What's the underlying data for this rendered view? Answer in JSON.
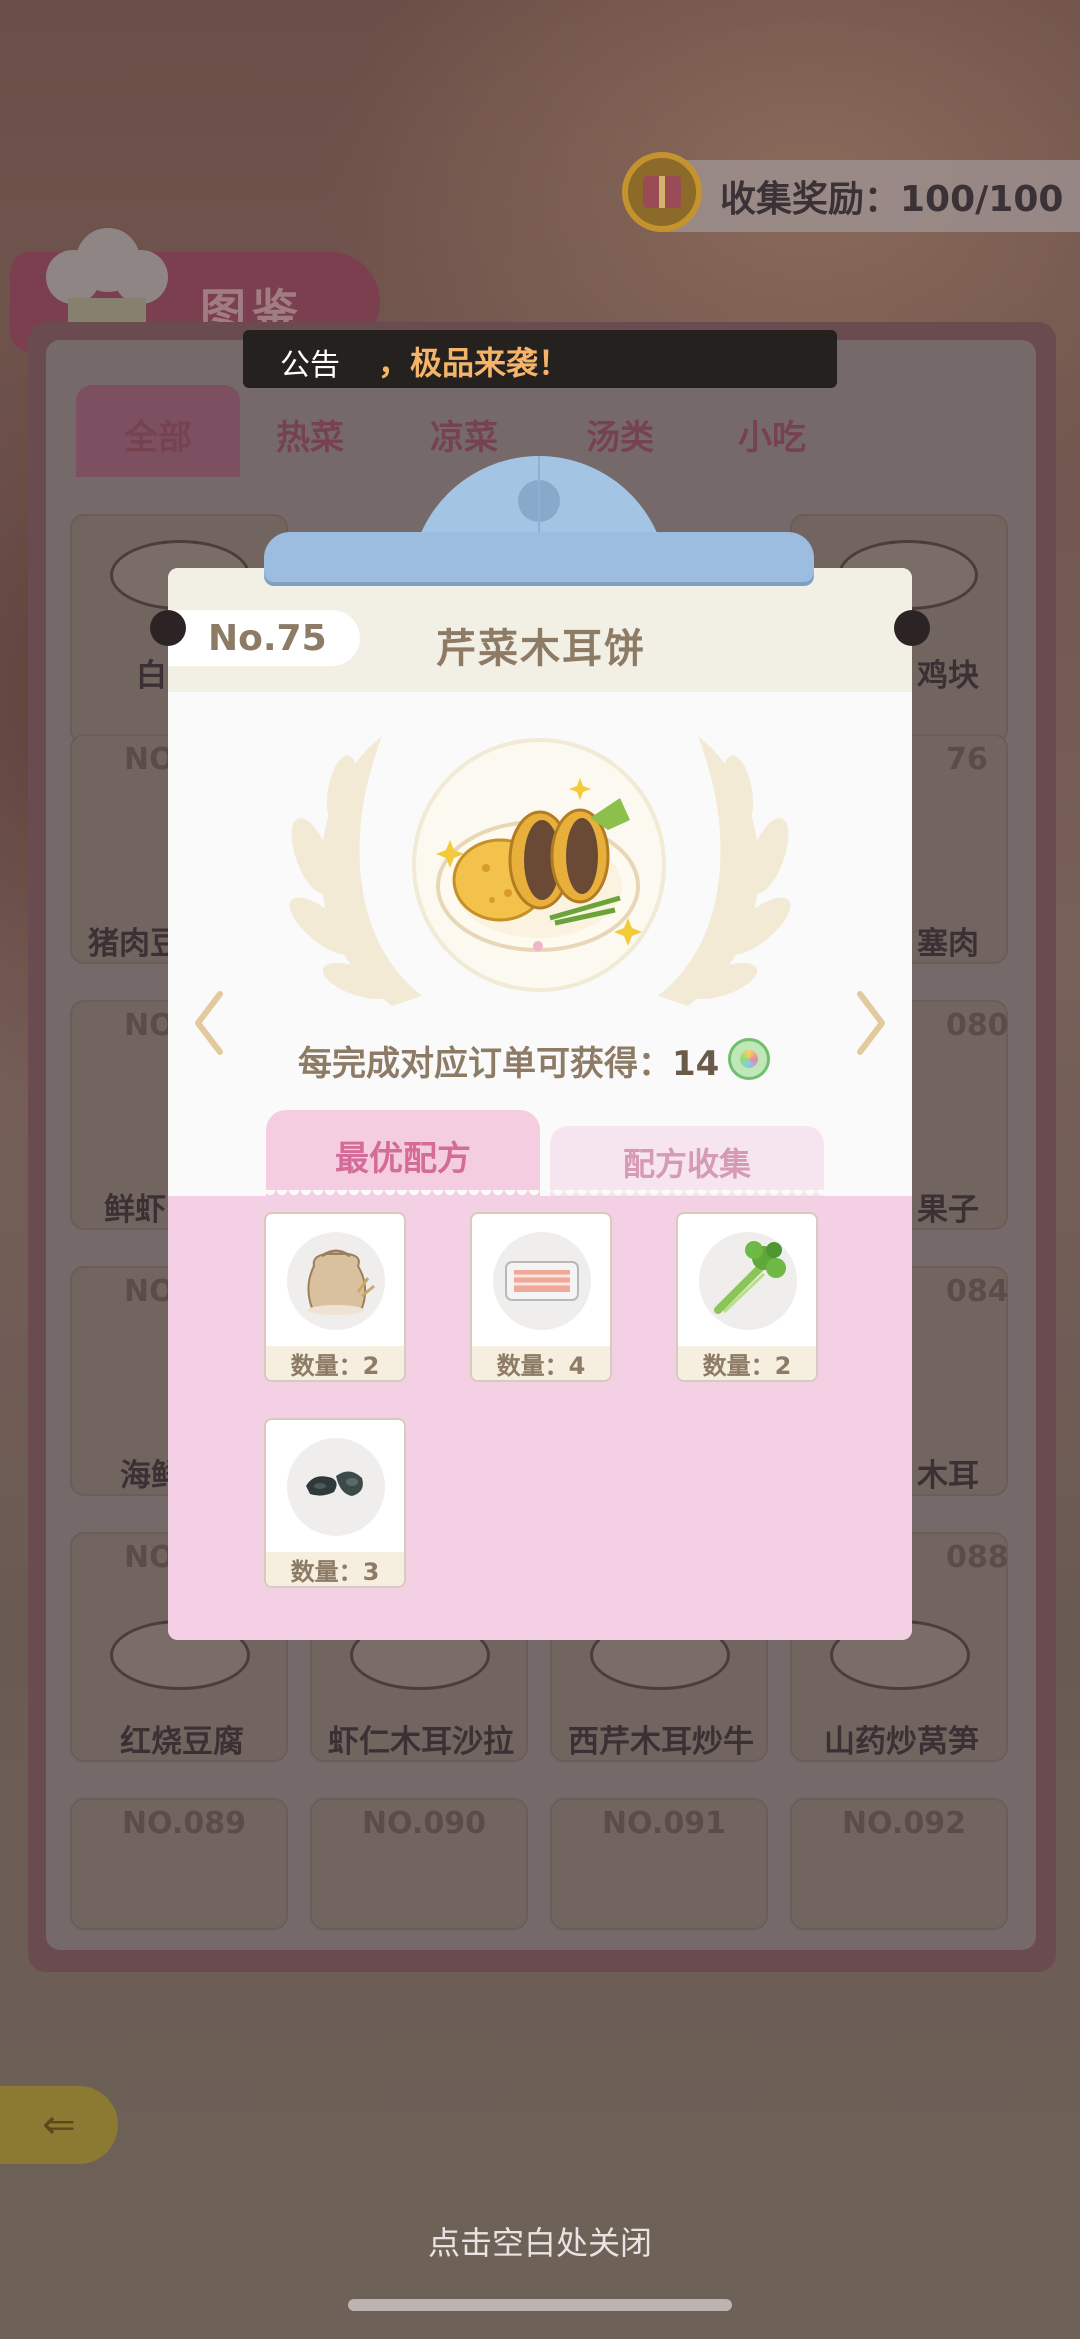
{
  "collection_reward": {
    "label": "收集奖励：100/100"
  },
  "book": {
    "title": "图鉴"
  },
  "announcement": {
    "label": "公告",
    "message": "，极品来袭！"
  },
  "category_tabs": [
    "全部",
    "热菜",
    "凉菜",
    "汤类",
    "小吃"
  ],
  "bg_cards": {
    "row1": [
      "白",
      "鸡块"
    ],
    "row2_nos": [
      "NO",
      "76"
    ],
    "row2_names": [
      "猪肉豆",
      "塞肉"
    ],
    "row3_nos": [
      "NO",
      "080"
    ],
    "row3_names": [
      "鲜虾",
      "果子"
    ],
    "row4_nos": [
      "NO",
      "084"
    ],
    "row4_names": [
      "海鲜",
      "木耳"
    ],
    "row5_nos": [
      "NO",
      "088"
    ],
    "row5_names": [
      "红烧豆腐",
      "虾仁木耳沙拉",
      "西芹木耳炒牛",
      "山药炒莴笋"
    ],
    "row6_nos": [
      "NO.089",
      "NO.090",
      "NO.091",
      "NO.092"
    ]
  },
  "modal": {
    "number": "No.75",
    "dish_name": "芹菜木耳饼",
    "reward_text": "每完成对应订单可获得：",
    "reward_amount": "14",
    "tab_best": "最优配方",
    "tab_collect": "配方收集",
    "ingredients": [
      {
        "icon": "flour-sack-icon",
        "qty": "数量：2"
      },
      {
        "icon": "pork-meat-icon",
        "qty": "数量：4"
      },
      {
        "icon": "celery-icon",
        "qty": "数量：2"
      },
      {
        "icon": "wood-ear-fungus-icon",
        "qty": "数量：3"
      }
    ]
  },
  "close_hint": "点击空白处关闭",
  "colors": {
    "accent_pink": "#d56b97",
    "text_brown": "#8d7b66",
    "clip_blue": "#a4c4e4"
  }
}
